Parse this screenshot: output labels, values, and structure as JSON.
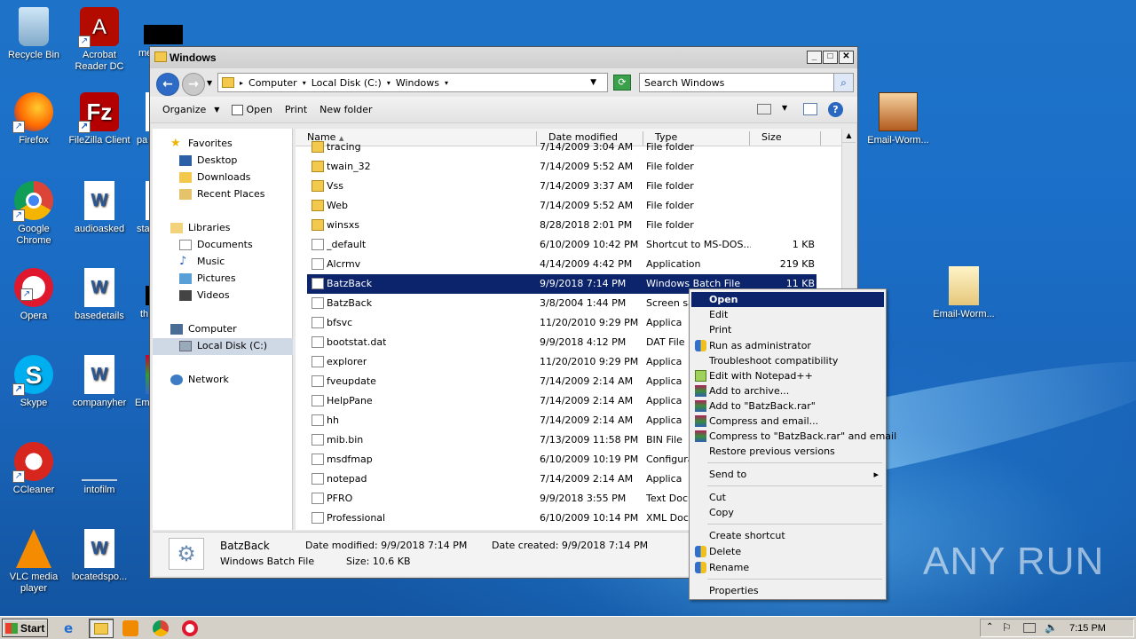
{
  "desktop": {
    "icons": [
      {
        "label": "Recycle Bin"
      },
      {
        "label": "Acrobat Reader DC"
      },
      {
        "label": "me"
      },
      {
        "label": "Firefox"
      },
      {
        "label": "FileZilla Client"
      },
      {
        "label": "pa"
      },
      {
        "label": "Google Chrome"
      },
      {
        "label": "audioasked"
      },
      {
        "label": "sta"
      },
      {
        "label": "Opera"
      },
      {
        "label": "basedetails"
      },
      {
        "label": "th"
      },
      {
        "label": "Skype"
      },
      {
        "label": "companyher"
      },
      {
        "label": "Em"
      },
      {
        "label": "CCleaner"
      },
      {
        "label": "intofilm"
      },
      {
        "label": "VLC media player"
      },
      {
        "label": "locatedspo..."
      },
      {
        "label": "Email-Worm..."
      },
      {
        "label": "Email-Worm..."
      }
    ]
  },
  "window": {
    "title": "Windows",
    "address": {
      "crumbs": [
        "Computer",
        "Local Disk (C:)",
        "Windows"
      ]
    },
    "search_placeholder": "Search Windows",
    "toolbar": {
      "organize": "Organize",
      "open": "Open",
      "print": "Print",
      "new_folder": "New folder"
    },
    "nav": {
      "favorites": "Favorites",
      "desktop": "Desktop",
      "downloads": "Downloads",
      "recent": "Recent Places",
      "libraries": "Libraries",
      "documents": "Documents",
      "music": "Music",
      "pictures": "Pictures",
      "videos": "Videos",
      "computer": "Computer",
      "local_disk": "Local Disk (C:)",
      "network": "Network"
    },
    "columns": {
      "name": "Name",
      "date": "Date modified",
      "type": "Type",
      "size": "Size"
    },
    "files": [
      {
        "name": "tracing",
        "date": "7/14/2009 3:04 AM",
        "type": "File folder",
        "size": ""
      },
      {
        "name": "twain_32",
        "date": "7/14/2009 5:52 AM",
        "type": "File folder",
        "size": ""
      },
      {
        "name": "Vss",
        "date": "7/14/2009 3:37 AM",
        "type": "File folder",
        "size": ""
      },
      {
        "name": "Web",
        "date": "7/14/2009 5:52 AM",
        "type": "File folder",
        "size": ""
      },
      {
        "name": "winsxs",
        "date": "8/28/2018 2:01 PM",
        "type": "File folder",
        "size": ""
      },
      {
        "name": "_default",
        "date": "6/10/2009 10:42 PM",
        "type": "Shortcut to MS-DOS...",
        "size": "1 KB"
      },
      {
        "name": "Alcrmv",
        "date": "4/14/2009 4:42 PM",
        "type": "Application",
        "size": "219 KB"
      },
      {
        "name": "BatzBack",
        "date": "9/9/2018 7:14 PM",
        "type": "Windows Batch File",
        "size": "11 KB"
      },
      {
        "name": "BatzBack",
        "date": "3/8/2004 1:44 PM",
        "type": "Screen sa",
        "size": ""
      },
      {
        "name": "bfsvc",
        "date": "11/20/2010 9:29 PM",
        "type": "Applica",
        "size": ""
      },
      {
        "name": "bootstat.dat",
        "date": "9/9/2018 4:12 PM",
        "type": "DAT File",
        "size": ""
      },
      {
        "name": "explorer",
        "date": "11/20/2010 9:29 PM",
        "type": "Applica",
        "size": ""
      },
      {
        "name": "fveupdate",
        "date": "7/14/2009 2:14 AM",
        "type": "Applica",
        "size": ""
      },
      {
        "name": "HelpPane",
        "date": "7/14/2009 2:14 AM",
        "type": "Applica",
        "size": ""
      },
      {
        "name": "hh",
        "date": "7/14/2009 2:14 AM",
        "type": "Applica",
        "size": ""
      },
      {
        "name": "mib.bin",
        "date": "7/13/2009 11:58 PM",
        "type": "BIN File",
        "size": ""
      },
      {
        "name": "msdfmap",
        "date": "6/10/2009 10:19 PM",
        "type": "Configura",
        "size": ""
      },
      {
        "name": "notepad",
        "date": "7/14/2009 2:14 AM",
        "type": "Applica",
        "size": ""
      },
      {
        "name": "PFRO",
        "date": "9/9/2018 3:55 PM",
        "type": "Text Docu",
        "size": ""
      },
      {
        "name": "Professional",
        "date": "6/10/2009 10:14 PM",
        "type": "XML Docu",
        "size": ""
      }
    ],
    "details": {
      "name": "BatzBack",
      "type": "Windows Batch File",
      "modified": "Date modified: 9/9/2018 7:14 PM",
      "size": "Size: 10.6 KB",
      "created": "Date created: 9/9/2018 7:14 PM"
    }
  },
  "context_menu": {
    "open": "Open",
    "edit": "Edit",
    "print": "Print",
    "run_admin": "Run as administrator",
    "troubleshoot": "Troubleshoot compatibility",
    "notepadpp": "Edit with Notepad++",
    "add_archive": "Add to archive...",
    "add_rar": "Add to \"BatzBack.rar\"",
    "compress_email": "Compress and email...",
    "compress_rar_email": "Compress to \"BatzBack.rar\" and email",
    "restore": "Restore previous versions",
    "send_to": "Send to",
    "cut": "Cut",
    "copy": "Copy",
    "create_shortcut": "Create shortcut",
    "delete": "Delete",
    "rename": "Rename",
    "properties": "Properties"
  },
  "taskbar": {
    "start": "Start",
    "clock": "7:15 PM"
  },
  "watermark": "ANY RUN",
  "colors": {
    "selection": "#0b246b",
    "desktop": "#1b6fc8"
  }
}
